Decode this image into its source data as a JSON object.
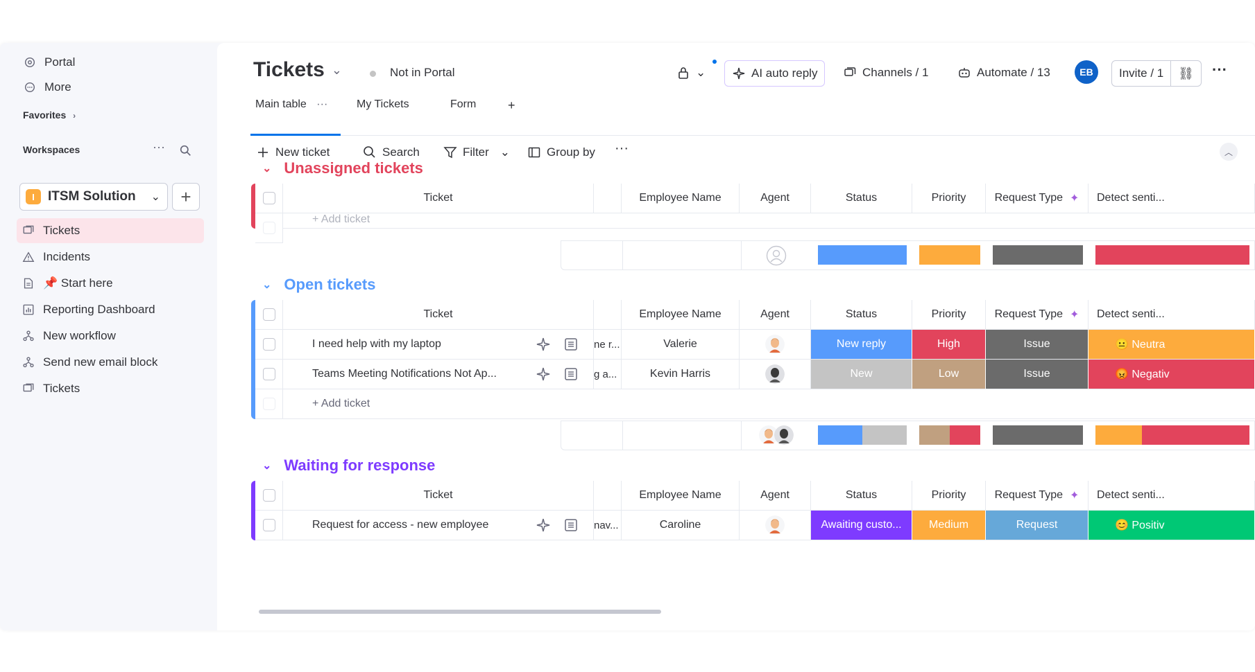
{
  "sidebar": {
    "top_items": [
      {
        "label": "Portal",
        "icon": "portal-icon"
      },
      {
        "label": "More",
        "icon": "more-icon"
      }
    ],
    "favorites_label": "Favorites",
    "workspaces_label": "Workspaces",
    "workspace": {
      "badge": "I",
      "name": "ITSM Solution"
    },
    "items": [
      {
        "label": "Tickets",
        "icon": "board-icon",
        "active": true
      },
      {
        "label": "Incidents",
        "icon": "warning-icon"
      },
      {
        "label": "📌 Start here",
        "icon": "doc-icon"
      },
      {
        "label": "Reporting Dashboard",
        "icon": "dashboard-icon"
      },
      {
        "label": "New workflow",
        "icon": "workflow-icon"
      },
      {
        "label": "Send new email block",
        "icon": "workflow-icon"
      },
      {
        "label": "Tickets",
        "icon": "board-icon"
      }
    ]
  },
  "header": {
    "title": "Tickets",
    "portal_status": "Not in Portal",
    "ai_auto_reply": "AI auto reply",
    "channels": "Channels / 1",
    "automate": "Automate / 13",
    "avatar_initials": "EB",
    "invite": "Invite / 1"
  },
  "tabs": [
    {
      "label": "Main table",
      "active": true
    },
    {
      "label": "My Tickets"
    },
    {
      "label": "Form"
    },
    {
      "label": "+"
    }
  ],
  "toolbar": {
    "new_ticket": "New ticket",
    "search": "Search",
    "filter": "Filter",
    "group_by": "Group by"
  },
  "columns": {
    "ticket": "Ticket",
    "employee": "Employee Name",
    "agent": "Agent",
    "status": "Status",
    "priority": "Priority",
    "request_type": "Request Type",
    "sentiment": "Detect senti..."
  },
  "add_ticket_label": "+ Add ticket",
  "colors": {
    "blue": "#579bfc",
    "orange": "#fdab3d",
    "dark_gray": "#6b6b6b",
    "red": "#e2445c",
    "gray": "#c4c4c4",
    "tan": "#c0a080",
    "purple": "#7e3bff",
    "light_blue": "#66a8d9",
    "green": "#00c875",
    "accent": "#0073ea"
  },
  "groups": [
    {
      "title": "Unassigned tickets",
      "color": "#e2445c",
      "rows": []
    },
    {
      "title": "Open tickets",
      "color": "#579bfc",
      "rows": [
        {
          "ticket": "I need help with my laptop",
          "snippet": "ne r...",
          "employee": "Valerie",
          "status": "New reply",
          "priority": "High",
          "request_type": "Issue",
          "sentiment": "😐 Neutra"
        },
        {
          "ticket": "Teams Meeting Notifications Not Ap...",
          "snippet": "g a...",
          "employee": "Kevin Harris",
          "status": "New",
          "priority": "Low",
          "request_type": "Issue",
          "sentiment": "😡 Negativ"
        }
      ]
    },
    {
      "title": "Waiting for response",
      "color": "#7e3bff",
      "rows": [
        {
          "ticket": "Request for access - new employee",
          "snippet": "nav...",
          "employee": "Caroline",
          "status": "Awaiting custo...",
          "priority": "Medium",
          "request_type": "Request",
          "sentiment": "😊 Positiv"
        }
      ]
    }
  ]
}
